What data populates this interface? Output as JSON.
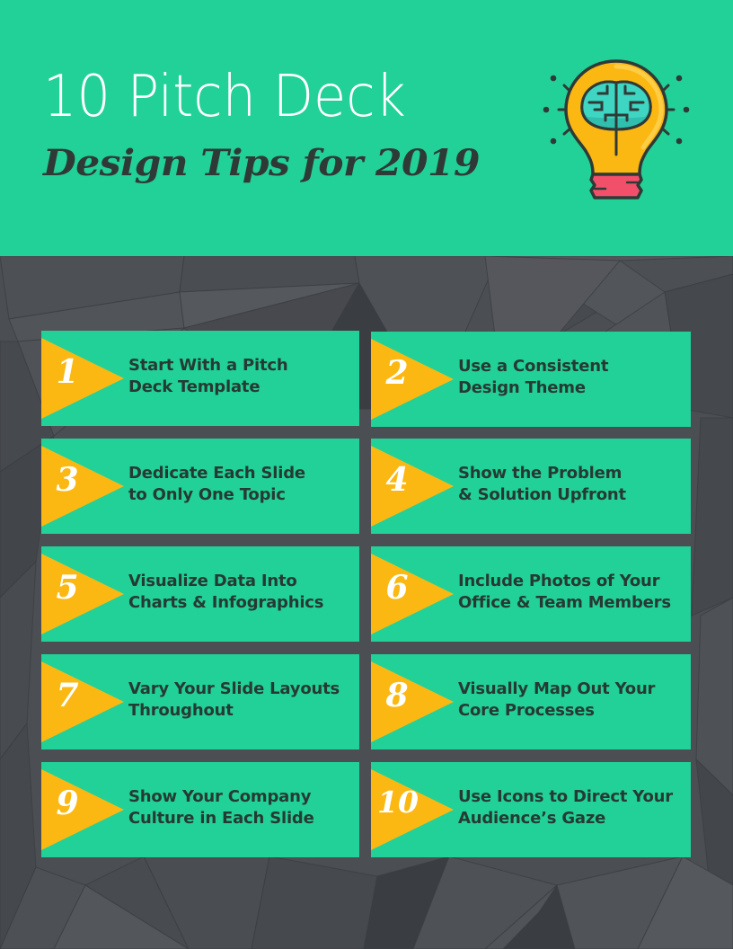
{
  "header": {
    "title_line1": "10 Pitch Deck",
    "title_line2": "Design Tips for 2019",
    "illustration": "lightbulb-brain-icon",
    "background_color": "#22d197"
  },
  "colors": {
    "card_bg": "#22d197",
    "triangle": "#fbb812",
    "number_text": "#ffffff",
    "tip_text": "#263a34",
    "background": "#4a4d52"
  },
  "tips": [
    {
      "number": "1",
      "line1": "Start With a Pitch",
      "line2": "Deck Template"
    },
    {
      "number": "2",
      "line1": "Use a Consistent",
      "line2": "Design Theme"
    },
    {
      "number": "3",
      "line1": "Dedicate Each Slide",
      "line2": "to Only One Topic"
    },
    {
      "number": "4",
      "line1": "Show the Problem",
      "line2": "& Solution Upfront"
    },
    {
      "number": "5",
      "line1": "Visualize Data Into",
      "line2": "Charts & Infographics"
    },
    {
      "number": "6",
      "line1": "Include Photos of Your",
      "line2": "Office & Team Members"
    },
    {
      "number": "7",
      "line1": "Vary Your Slide Layouts",
      "line2": "Throughout"
    },
    {
      "number": "8",
      "line1": "Visually Map Out Your",
      "line2": "Core Processes"
    },
    {
      "number": "9",
      "line1": "Show Your Company",
      "line2": "Culture in Each Slide"
    },
    {
      "number": "10",
      "line1": "Use Icons to Direct Your",
      "line2": "Audience’s Gaze"
    }
  ]
}
